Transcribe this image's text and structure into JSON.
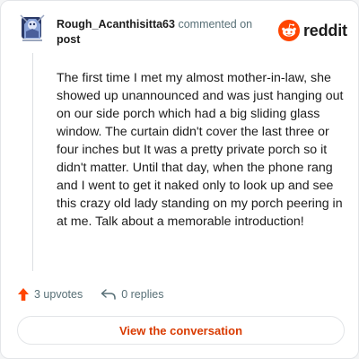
{
  "header": {
    "username": "Rough_Acanthisitta63",
    "action_text": "commented on",
    "post_link": "post",
    "brand": "reddit"
  },
  "comment": {
    "body": "The first time I met my almost mother-in-law, she showed up unannounced and was just hanging out on our side porch which had a big sliding glass window. The curtain didn't cover the last three or four inches but It was a pretty private porch so it didn't matter. Until that day, when the phone rang and I went to get it naked only to look up and see this crazy old lady standing on my porch peering in at me. Talk about a memorable introduction!"
  },
  "stats": {
    "upvotes": "3 upvotes",
    "replies": "0 replies"
  },
  "cta": {
    "label": "View the conversation"
  },
  "colors": {
    "brand_orange": "#ff4500",
    "cta_text": "#d93a00",
    "muted": "#576f76"
  },
  "icons": {
    "avatar": "snoo-avatar-icon",
    "logo": "reddit-logo-icon",
    "upvote": "upvote-arrow-icon",
    "reply": "reply-arrow-icon"
  }
}
